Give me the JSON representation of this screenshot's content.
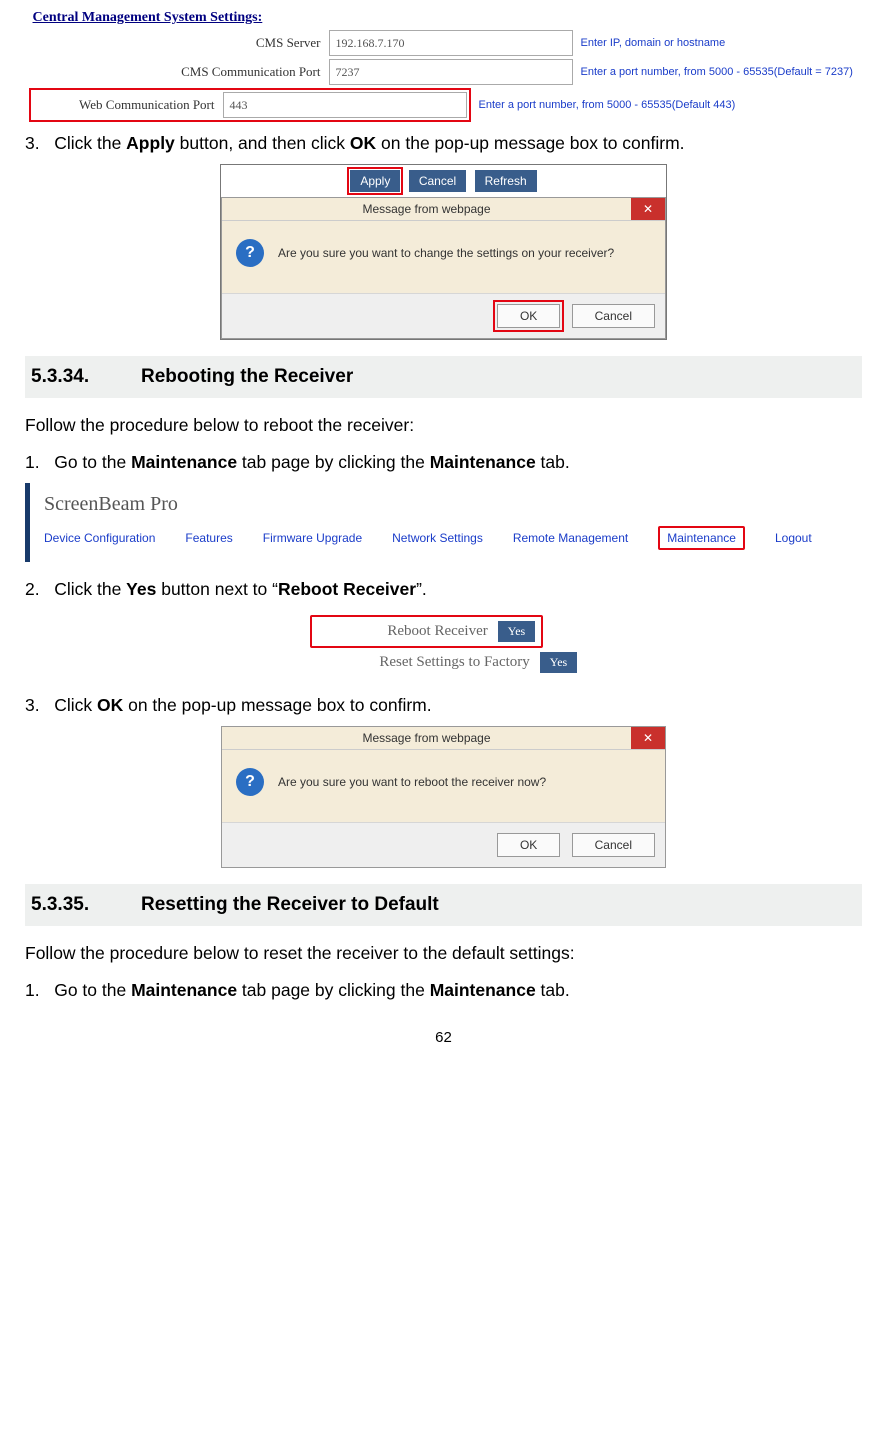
{
  "cms": {
    "title": "Central Management System Settings:",
    "rows": [
      {
        "label": "CMS Server",
        "value": "192.168.7.170",
        "hint": "Enter IP, domain or hostname"
      },
      {
        "label": "CMS Communication Port",
        "value": "7237",
        "hint": "Enter a port number, from 5000 - 65535(Default = 7237)"
      },
      {
        "label": "Web Communication Port",
        "value": "443",
        "hint": "Enter a port number, from 5000 - 65535(Default    443)"
      }
    ]
  },
  "step3a": {
    "num": "3.",
    "pre": "Click the ",
    "b1": "Apply",
    "mid": " button, and then click ",
    "b2": "OK",
    "post": " on the pop-up message box to confirm."
  },
  "toolbar": {
    "apply": "Apply",
    "cancel": "Cancel",
    "refresh": "Refresh"
  },
  "msg1": {
    "title": "Message from webpage",
    "text": "Are you sure you want to change the settings on your receiver?",
    "ok": "OK",
    "cancel": "Cancel"
  },
  "sec34": {
    "num": "5.3.34.",
    "title": "Rebooting the Receiver"
  },
  "sec34_intro": "Follow the procedure below to reboot the receiver:",
  "sec34_s1": {
    "num": "1.",
    "pre": "Go to the ",
    "b1": "Maintenance",
    "mid": " tab page by clicking the ",
    "b2": "Maintenance",
    "post": " tab."
  },
  "sb": {
    "logo": "ScreenBeam Pro",
    "tabs": [
      "Device Configuration",
      "Features",
      "Firmware Upgrade",
      "Network Settings",
      "Remote Management",
      "Maintenance",
      "Logout"
    ]
  },
  "sec34_s2": {
    "num": "2.",
    "pre": "Click the ",
    "b1": "Yes",
    "mid": " button next to “",
    "b2": "Reboot Receiver",
    "post": "”."
  },
  "reboot": {
    "row1": "Reboot Receiver",
    "row2": "Reset Settings to Factory",
    "yes": "Yes"
  },
  "sec34_s3": {
    "num": "3.",
    "pre": "Click ",
    "b1": "OK",
    "post": " on the pop-up message box to confirm."
  },
  "msg2": {
    "title": "Message from webpage",
    "text": "Are you sure you want to reboot the receiver now?",
    "ok": "OK",
    "cancel": "Cancel"
  },
  "sec35": {
    "num": "5.3.35.",
    "title": "Resetting the Receiver to Default"
  },
  "sec35_intro": "Follow the procedure below to reset the receiver to the default settings:",
  "sec35_s1": {
    "num": "1.",
    "pre": "Go to the ",
    "b1": "Maintenance",
    "mid": " tab page by clicking the ",
    "b2": "Maintenance",
    "post": " tab."
  },
  "page_number": "62"
}
